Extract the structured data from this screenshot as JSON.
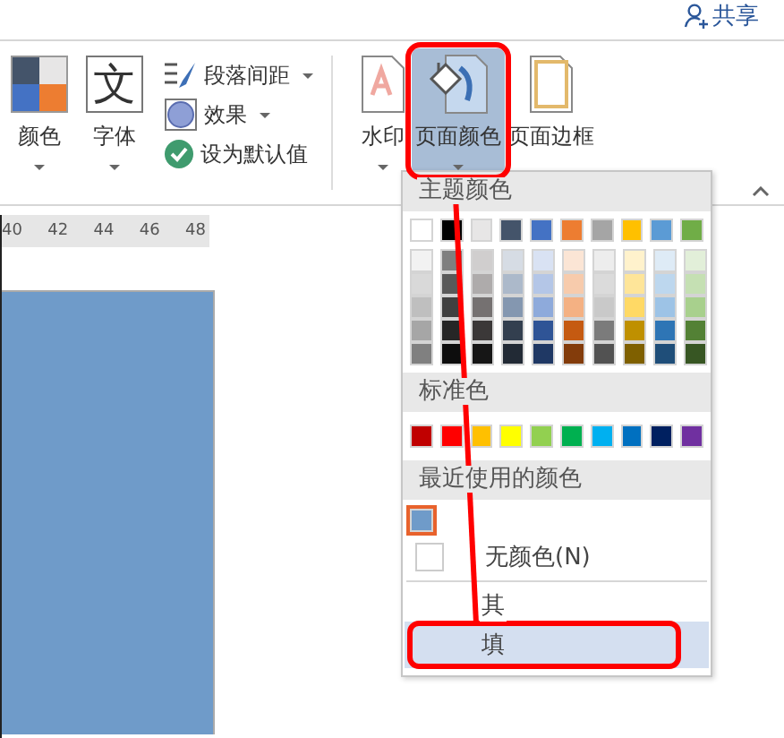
{
  "title_bar": {
    "share": "共享"
  },
  "ribbon": {
    "large_buttons": [
      {
        "label": "颜色",
        "kind": "colors",
        "dropdown": true
      },
      {
        "label": "字体",
        "kind": "fonts",
        "glyph": "文",
        "dropdown": true
      }
    ],
    "small_buttons": [
      {
        "label": "段落间距",
        "kind": "spacing",
        "dropdown": true
      },
      {
        "label": "效果",
        "kind": "effects",
        "dropdown": true
      },
      {
        "label": "设为默认值",
        "kind": "default",
        "dropdown": false
      }
    ],
    "background_buttons": [
      {
        "label": "水印",
        "kind": "watermark",
        "dropdown": true,
        "selected": false
      },
      {
        "label": "页面颜色",
        "kind": "page_color",
        "dropdown": true,
        "selected": true
      },
      {
        "label": "页面边框",
        "kind": "page_border",
        "dropdown": false,
        "selected": false
      }
    ]
  },
  "ruler": {
    "ticks": [
      "40",
      "42",
      "44",
      "46",
      "48"
    ]
  },
  "page_color_menu": {
    "theme_header": "主题颜色",
    "theme_colors": [
      {
        "color": "#ffffff",
        "shades": [
          {
            "color": "#f2f2f2"
          },
          {
            "color": "#d9d9d9"
          },
          {
            "color": "#bfbfbf"
          },
          {
            "color": "#a6a6a6"
          },
          {
            "color": "#808080"
          }
        ]
      },
      {
        "color": "#000000",
        "shades": [
          {
            "color": "#7f7f7f"
          },
          {
            "color": "#595959"
          },
          {
            "color": "#404040"
          },
          {
            "color": "#262626"
          },
          {
            "color": "#0d0d0d"
          }
        ]
      },
      {
        "color": "#e7e6e6",
        "shades": [
          {
            "color": "#d0cece"
          },
          {
            "color": "#aeabab"
          },
          {
            "color": "#757171"
          },
          {
            "color": "#3b3838"
          },
          {
            "color": "#161616"
          }
        ]
      },
      {
        "color": "#44546a",
        "shades": [
          {
            "color": "#d6dce4"
          },
          {
            "color": "#acb9ca"
          },
          {
            "color": "#8497b0"
          },
          {
            "color": "#333f4f"
          },
          {
            "color": "#222a35"
          }
        ]
      },
      {
        "color": "#4472c4",
        "shades": [
          {
            "color": "#d9e2f3"
          },
          {
            "color": "#b4c6e7"
          },
          {
            "color": "#8eaadb"
          },
          {
            "color": "#2f5496"
          },
          {
            "color": "#1f3864"
          }
        ]
      },
      {
        "color": "#ed7d31",
        "shades": [
          {
            "color": "#fbe5d5"
          },
          {
            "color": "#f7cbac"
          },
          {
            "color": "#f4b183"
          },
          {
            "color": "#c55a11"
          },
          {
            "color": "#833c0b"
          }
        ]
      },
      {
        "color": "#a5a5a5",
        "shades": [
          {
            "color": "#ededed"
          },
          {
            "color": "#dbdbdb"
          },
          {
            "color": "#c9c9c9"
          },
          {
            "color": "#7b7b7b"
          },
          {
            "color": "#525252"
          }
        ]
      },
      {
        "color": "#ffc000",
        "shades": [
          {
            "color": "#fff2cc"
          },
          {
            "color": "#fee599"
          },
          {
            "color": "#ffd965"
          },
          {
            "color": "#bf9000"
          },
          {
            "color": "#7f6000"
          }
        ]
      },
      {
        "color": "#5b9bd5",
        "shades": [
          {
            "color": "#deebf6"
          },
          {
            "color": "#bdd7ee"
          },
          {
            "color": "#9dc3e6"
          },
          {
            "color": "#2e75b5"
          },
          {
            "color": "#1f4e79"
          }
        ]
      },
      {
        "color": "#70ad47",
        "shades": [
          {
            "color": "#e2efd9"
          },
          {
            "color": "#c5e0b3"
          },
          {
            "color": "#a8d08d"
          },
          {
            "color": "#538135"
          },
          {
            "color": "#375623"
          }
        ]
      }
    ],
    "standard_header": "标准色",
    "standard_colors": [
      {
        "color": "#c00000"
      },
      {
        "color": "#ff0000"
      },
      {
        "color": "#ffc000"
      },
      {
        "color": "#ffff00"
      },
      {
        "color": "#92d050"
      },
      {
        "color": "#00b050"
      },
      {
        "color": "#00b0f0"
      },
      {
        "color": "#0070c0"
      },
      {
        "color": "#002060"
      },
      {
        "color": "#7030a0"
      }
    ],
    "recent_header": "最近使用的颜色",
    "recent_colors": [
      {
        "color": "#6f9bc9",
        "selected": true
      }
    ],
    "items": [
      {
        "label": "无颜色(N)",
        "kind": "no_color",
        "selected": false
      },
      {
        "label": "其",
        "kind": "plain",
        "selected": false
      },
      {
        "label": "填",
        "kind": "plain",
        "selected": true
      }
    ]
  }
}
